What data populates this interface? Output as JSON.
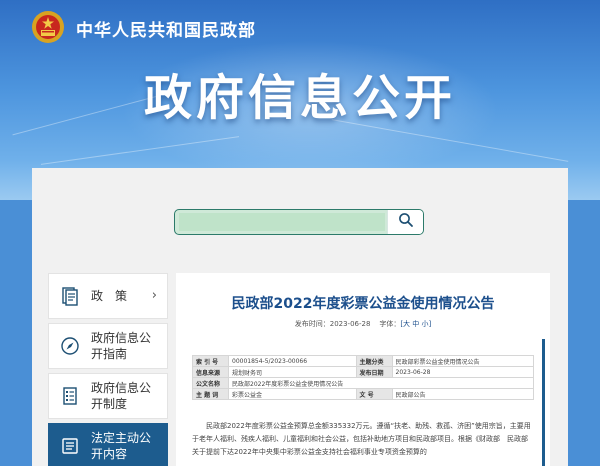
{
  "header": {
    "ministry_name": "中华人民共和国民政部",
    "page_title": "政府信息公开"
  },
  "search": {
    "value": "",
    "placeholder": ""
  },
  "sidebar": {
    "items": [
      {
        "label": "政　策",
        "icon": "document-list-icon",
        "arrow": "›"
      },
      {
        "label": "政府信息公开指南",
        "icon": "compass-icon"
      },
      {
        "label": "政府信息公开制度",
        "icon": "rulebook-icon"
      },
      {
        "label": "法定主动公开内容",
        "icon": "folder-list-icon"
      }
    ]
  },
  "article": {
    "title": "民政部2022年度彩票公益金使用情况公告",
    "publish_label": "发布时间：",
    "publish_date": "2023-06-28",
    "font_label": "字体：",
    "font_controls": "[大 中 小]",
    "info_rows": [
      {
        "k1": "索 引 号",
        "v1": "00001854-5/2023-00066",
        "k2": "主题分类",
        "v2": "民政部彩票公益金使用情况公告"
      },
      {
        "k1": "信息来源",
        "v1": "规划财务司",
        "k2": "发布日期",
        "v2": "2023-06-28"
      },
      {
        "k1": "公文名称",
        "v1": "民政部2022年度彩票公益金使用情况公告",
        "k2": "",
        "v2": ""
      },
      {
        "k1": "主 题 词",
        "v1": "彩票公益金",
        "k2": "文 号",
        "v2": "民政部公告"
      }
    ],
    "body": "民政部2022年度彩票公益金预算总金额335332万元。遵循“扶老、助残、救孤、济困”使用宗旨，主要用于老年人福利、残疾人福利、儿童福利和社会公益，包括补助地方项目和民政部项目。根据《财政部　民政部关于提前下达2022年中央集中彩票公益金支持社会福利事业专项资金预算的"
  },
  "colors": {
    "banner": "#2f6fc4",
    "sidebar_active": "#1d5c8e",
    "title_text": "#1c4f8c",
    "search_border": "#2c7a6a"
  }
}
